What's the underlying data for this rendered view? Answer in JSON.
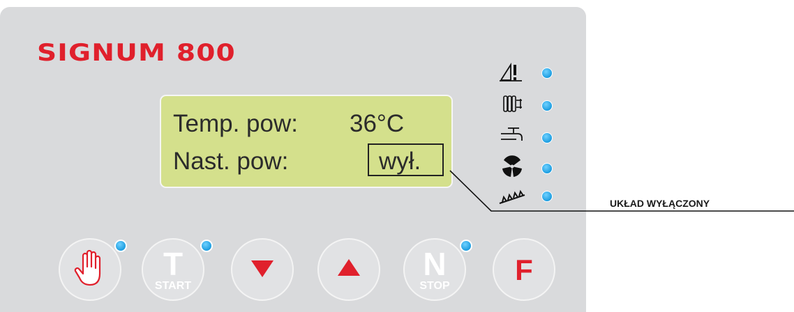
{
  "brand": {
    "name": "SIGNUM 800",
    "color": "#e0202c"
  },
  "display": {
    "background": "#d4e08c",
    "rows": [
      {
        "label": "Temp. pow:",
        "value": "36°C"
      },
      {
        "label": "Nast. pow:",
        "value": "wył."
      }
    ]
  },
  "indicators": [
    {
      "icon": "warning-icon",
      "led": "on"
    },
    {
      "icon": "radiator-icon",
      "led": "on"
    },
    {
      "icon": "tap-icon",
      "led": "on"
    },
    {
      "icon": "fan-icon",
      "led": "on"
    },
    {
      "icon": "auger-icon",
      "led": "on"
    }
  ],
  "callout": {
    "text": "UKŁAD WYŁĄCZONY"
  },
  "buttons": [
    {
      "name": "manual",
      "icon": "hand-icon",
      "led": true
    },
    {
      "name": "start",
      "letter": "T",
      "sub": "START",
      "led": true
    },
    {
      "name": "down",
      "icon": "arrow-down-icon",
      "led": false
    },
    {
      "name": "up",
      "icon": "arrow-up-icon",
      "led": false
    },
    {
      "name": "stop",
      "letter": "N",
      "sub": "STOP",
      "led": true
    },
    {
      "name": "function",
      "letter": "F",
      "led": false
    }
  ],
  "colors": {
    "panel": "#d9dadc",
    "led": "#1d9de0",
    "accent": "#e0202c"
  }
}
